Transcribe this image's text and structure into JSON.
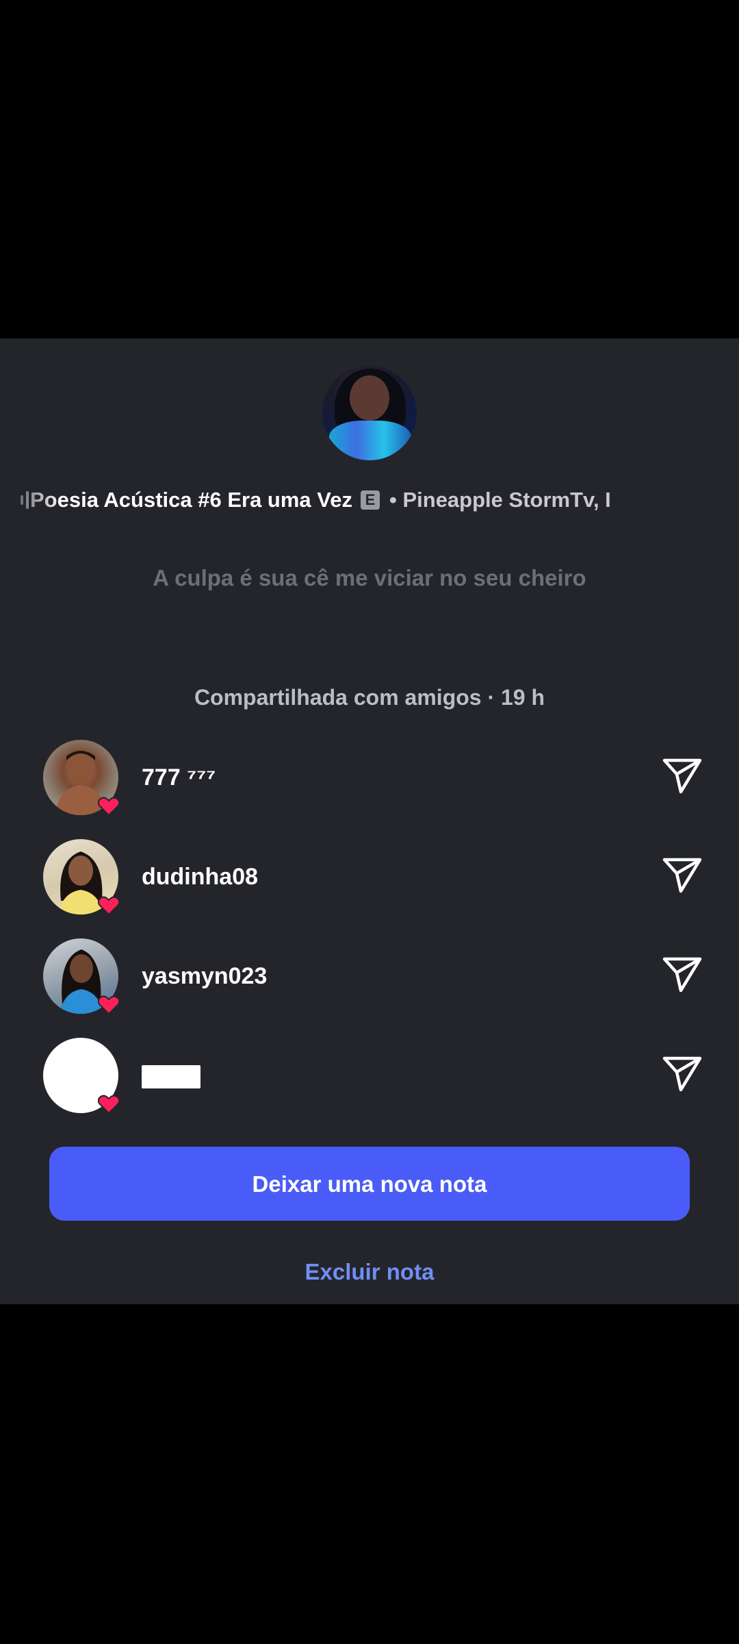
{
  "profile": {
    "avatar": "profile-avatar-photo"
  },
  "music": {
    "song_title": "Poesia Acústica #6 Era uma Vez",
    "explicit_badge": "E",
    "separator_and_artist": "• Pineapple StormTv, I"
  },
  "note": {
    "text": "A culpa é sua cê me viciar no seu cheiro"
  },
  "shared": {
    "label": "Compartilhada com amigos · 19 h"
  },
  "viewers": [
    {
      "name": "777 ⁷⁷⁷",
      "liked": true,
      "avatar": "male-avatar-photo"
    },
    {
      "name": "dudinha08",
      "liked": true,
      "avatar": "female-avatar-photo"
    },
    {
      "name": "yasmyn023",
      "liked": true,
      "avatar": "female-avatar-photo"
    },
    {
      "name": "",
      "liked": true,
      "avatar": "redacted-white-avatar"
    }
  ],
  "actions": {
    "new_note_label": "Deixar uma nova nota",
    "delete_note_label": "Excluir nota"
  },
  "colors": {
    "sheet_background": "#24252b",
    "primary_button": "#4a5cf7",
    "link": "#6f8ff5",
    "heart": "#ff1f5a"
  }
}
